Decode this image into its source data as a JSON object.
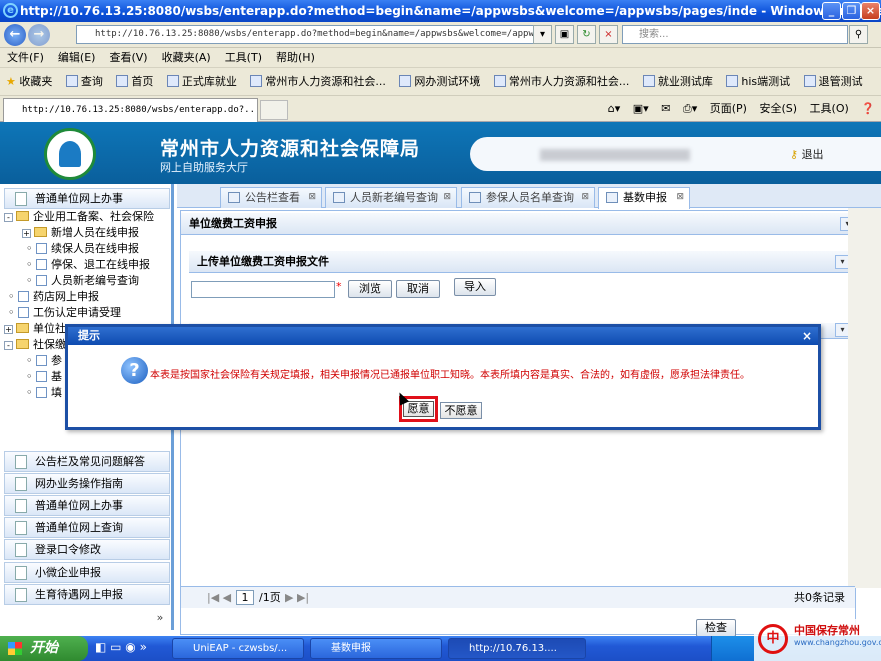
{
  "window": {
    "title": "http://10.76.13.25:8080/wsbs/enterapp.do?method=begin&name=/appwsbs&welcome=/appwsbs/pages/inde - Windows Interne..."
  },
  "address_bar": {
    "url": "http://10.76.13.25:8080/wsbs/enterapp.do?method=begin&name=/appwsbs&welcome=/appwsbs/",
    "search_placeholder": "搜索..."
  },
  "menu": [
    "文件(F)",
    "编辑(E)",
    "查看(V)",
    "收藏夹(A)",
    "工具(T)",
    "帮助(H)"
  ],
  "favorites": {
    "label": "收藏夹",
    "items": [
      "查询",
      "首页",
      "正式库就业",
      "常州市人力资源和社会...",
      "网办测试环境",
      "常州市人力资源和社会...",
      "就业测试库",
      "his端测试",
      "退管测试"
    ]
  },
  "ie_tab": {
    "title": "http://10.76.13.25:8080/wsbs/enterapp.do?...",
    "tools": [
      "页面(P)",
      "安全(S)",
      "工具(O)"
    ]
  },
  "site": {
    "title": "常州市人力资源和社会保障局",
    "subtitle": "网上自助服务大厅",
    "logout": "退出"
  },
  "sidebar": {
    "top_header": "普通单位网上办事",
    "tree": [
      {
        "label": "企业用工备案、社会保险",
        "level": 0,
        "type": "folder",
        "toggle": "-"
      },
      {
        "label": "新增人员在线申报",
        "level": 1,
        "type": "folder",
        "toggle": "+"
      },
      {
        "label": "续保人员在线申报",
        "level": 1,
        "type": "page",
        "toggle": ""
      },
      {
        "label": "停保、退工在线申报",
        "level": 1,
        "type": "page",
        "toggle": ""
      },
      {
        "label": "人员新老编号查询",
        "level": 1,
        "type": "page",
        "toggle": ""
      },
      {
        "label": "药店网上申报",
        "level": 0,
        "type": "page",
        "toggle": ""
      },
      {
        "label": "工伤认定申请受理",
        "level": 0,
        "type": "page",
        "toggle": ""
      },
      {
        "label": "单位社",
        "level": 0,
        "type": "folder",
        "toggle": "+"
      },
      {
        "label": "社保缴",
        "level": 0,
        "type": "folder",
        "toggle": "-"
      },
      {
        "label": "参",
        "level": 1,
        "type": "page",
        "toggle": ""
      },
      {
        "label": "基",
        "level": 1,
        "type": "page",
        "toggle": ""
      },
      {
        "label": "填",
        "level": 1,
        "type": "page",
        "toggle": ""
      }
    ],
    "bottom_headers": [
      "公告栏及常见问题解答",
      "网办业务操作指南",
      "普通单位网上办事",
      "普通单位网上查询",
      "登录口令修改",
      "小微企业申报",
      "生育待遇网上申报"
    ],
    "collapse": "»"
  },
  "content_tabs": [
    "公告栏查看",
    "人员新老编号查询",
    "参保人员名单查询",
    "基数申报"
  ],
  "panel": {
    "title": "单位缴费工资申报",
    "upload_title": "上传单位缴费工资申报文件",
    "required_mark": "*",
    "browse": "浏览",
    "cancel": "取消",
    "import": "导入",
    "pager_page": "1",
    "pager_total": "/1页",
    "records": "共0条记录",
    "check_button": "检查"
  },
  "dialog": {
    "title": "提示",
    "close": "×",
    "message": "本表是按国家社会保险有关规定填报，相关申报情况已通报单位职工知晓。本表所填内容是真实、合法的，如有虚假，愿承担法律责任。",
    "yes": "愿意",
    "no": "不愿意"
  },
  "taskbar": {
    "start": "开始",
    "items": [
      "UniEAP - czwsbs/...",
      "基数申报",
      "http://10.76.13...."
    ]
  },
  "watermark": {
    "text": "中国保存常州",
    "url": "www.changzhou.gov.cn"
  },
  "colors": {
    "accent": "#0e76b8",
    "dialog_border": "#1c4fa5",
    "highlight": "#e0101a",
    "message": "#d00000"
  }
}
